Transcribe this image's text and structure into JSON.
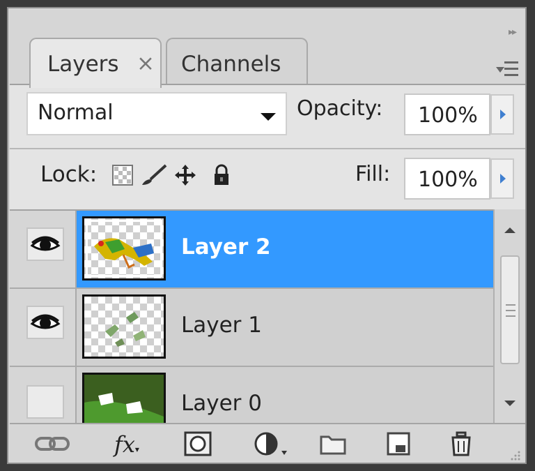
{
  "panel": {
    "tabs": [
      {
        "label": "Layers",
        "close": "×",
        "active": true
      },
      {
        "label": "Channels",
        "active": false
      }
    ],
    "collapse_icon": "double-chevron-right-icon",
    "menu_icon": "panel-menu-icon"
  },
  "options": {
    "blend_mode": "Normal",
    "opacity_label": "Opacity:",
    "opacity_value": "100%",
    "lock_label": "Lock:",
    "lock_icons": [
      "lock-transparent-pixels-icon",
      "lock-image-pixels-icon",
      "lock-position-icon",
      "lock-all-icon"
    ],
    "fill_label": "Fill:",
    "fill_value": "100%"
  },
  "layers": [
    {
      "name": "Layer 2",
      "visible": true,
      "selected": true
    },
    {
      "name": "Layer 1",
      "visible": true,
      "selected": false
    },
    {
      "name": "Layer 0",
      "visible": false,
      "selected": false
    }
  ],
  "footer": {
    "icons": [
      "link-layers-icon",
      "layer-style-fx-icon",
      "add-mask-icon",
      "adjustment-layer-icon",
      "new-group-icon",
      "new-layer-icon",
      "delete-layer-icon"
    ],
    "fx_text": "fx"
  },
  "colors": {
    "selection": "#3399ff",
    "panel_bg": "#d6d6d6"
  }
}
